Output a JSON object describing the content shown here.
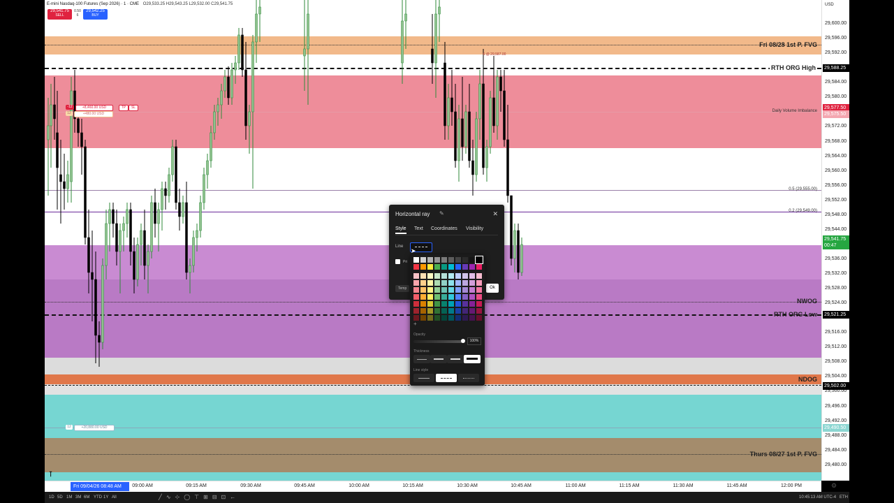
{
  "header": {
    "symbol": "E-mini Nasdaq-100 Futures (Sep 2026) · 1 · CME",
    "ohlc": "O29,533.25 H29,543.25 L29,532.00 C29,541.75",
    "sell_price": "29,541.75",
    "sell_label": "SELL",
    "spread": "0.50",
    "qty": "6",
    "buy_price": "29,542.25",
    "buy_label": "BUY"
  },
  "zones": {
    "fvg_top": "Fri 08/28 1st P. FVG",
    "rth_high": "RTH ORG High",
    "dvi": "Daily Volume Imbalance",
    "fib_05": "0.5 (29,555.00)",
    "fib_02": "0.2 (29,549.00)",
    "nwog": "NWOG",
    "rth_low": "RTH ORG Low",
    "ndog": "NDOG",
    "fvg_bottom": "Thurs 08/27 1st P. FVG"
  },
  "orders": {
    "pos_qty": "-12",
    "pos_pnl": "+8,460.00 USD",
    "tp": "TP",
    "sl": "SL",
    "tp_qty": "12",
    "tp_pnl": "+480.00 USD",
    "sl_qty": "12",
    "sl_pnl": "+20,880.00 USD",
    "trade_marker": "6 @ 29,587.00"
  },
  "yaxis": {
    "currency": "USD",
    "ticks": [
      "29,600.00",
      "29,596.00",
      "29,592.00",
      "29,584.00",
      "29,580.00",
      "29,572.00",
      "29,568.00",
      "29,564.00",
      "29,560.00",
      "29,556.00",
      "29,552.00",
      "29,548.00",
      "29,544.00",
      "29,536.00",
      "29,532.00",
      "29,528.00",
      "29,524.00",
      "29,516.00",
      "29,512.00",
      "29,508.00",
      "29,504.00",
      "29,500.00",
      "29,496.00",
      "29,492.00",
      "29,488.00",
      "29,484.00",
      "29,480.00"
    ],
    "badge_rth_high": "29,588.25",
    "badge_sell": "29,577.50",
    "badge_tp": "29,575.50",
    "badge_last": "29,541.75",
    "badge_countdown": "00:47",
    "badge_rth_low": "29,521.25",
    "badge_ndog": "29,502.00",
    "badge_sl": "29,490.50"
  },
  "xaxis": {
    "cursor_label": "Fri 09/04/26   08:48 AM",
    "ticks": [
      "09:00 AM",
      "09:15 AM",
      "09:30 AM",
      "09:45 AM",
      "10:00 AM",
      "10:15 AM",
      "10:30 AM",
      "10:45 AM",
      "11:00 AM",
      "11:15 AM",
      "11:30 AM",
      "11:45 AM",
      "12:00 PM"
    ]
  },
  "bottombar": {
    "ranges": [
      "1D",
      "5D",
      "1M",
      "3M",
      "6M",
      "YTD",
      "1Y",
      "All"
    ],
    "clock": "10:45:13 AM UTC-4",
    "session": "ETH"
  },
  "dialog": {
    "title": "Horizontal ray",
    "tabs": [
      "Style",
      "Text",
      "Coordinates",
      "Visibility"
    ],
    "line_label": "Line",
    "price_label": "Pri",
    "template_label": "Temp",
    "ok_label": "Ok"
  },
  "palette": {
    "add_label": "+",
    "opacity_label": "Opacity",
    "opacity_value": "100%",
    "thickness_label": "Thickness",
    "linestyle_label": "Line style"
  },
  "colors": {
    "fvg_orange": "#f2b98a",
    "imbalance_red": "#ee8d9a",
    "nwog_purple": "#c07fcc",
    "ndog_orange": "#e0774a",
    "teal": "#76d6d2",
    "brown": "#a48c6c",
    "sell_red": "#e0223f",
    "buy_blue": "#2962ff",
    "last_green": "#26a641"
  }
}
